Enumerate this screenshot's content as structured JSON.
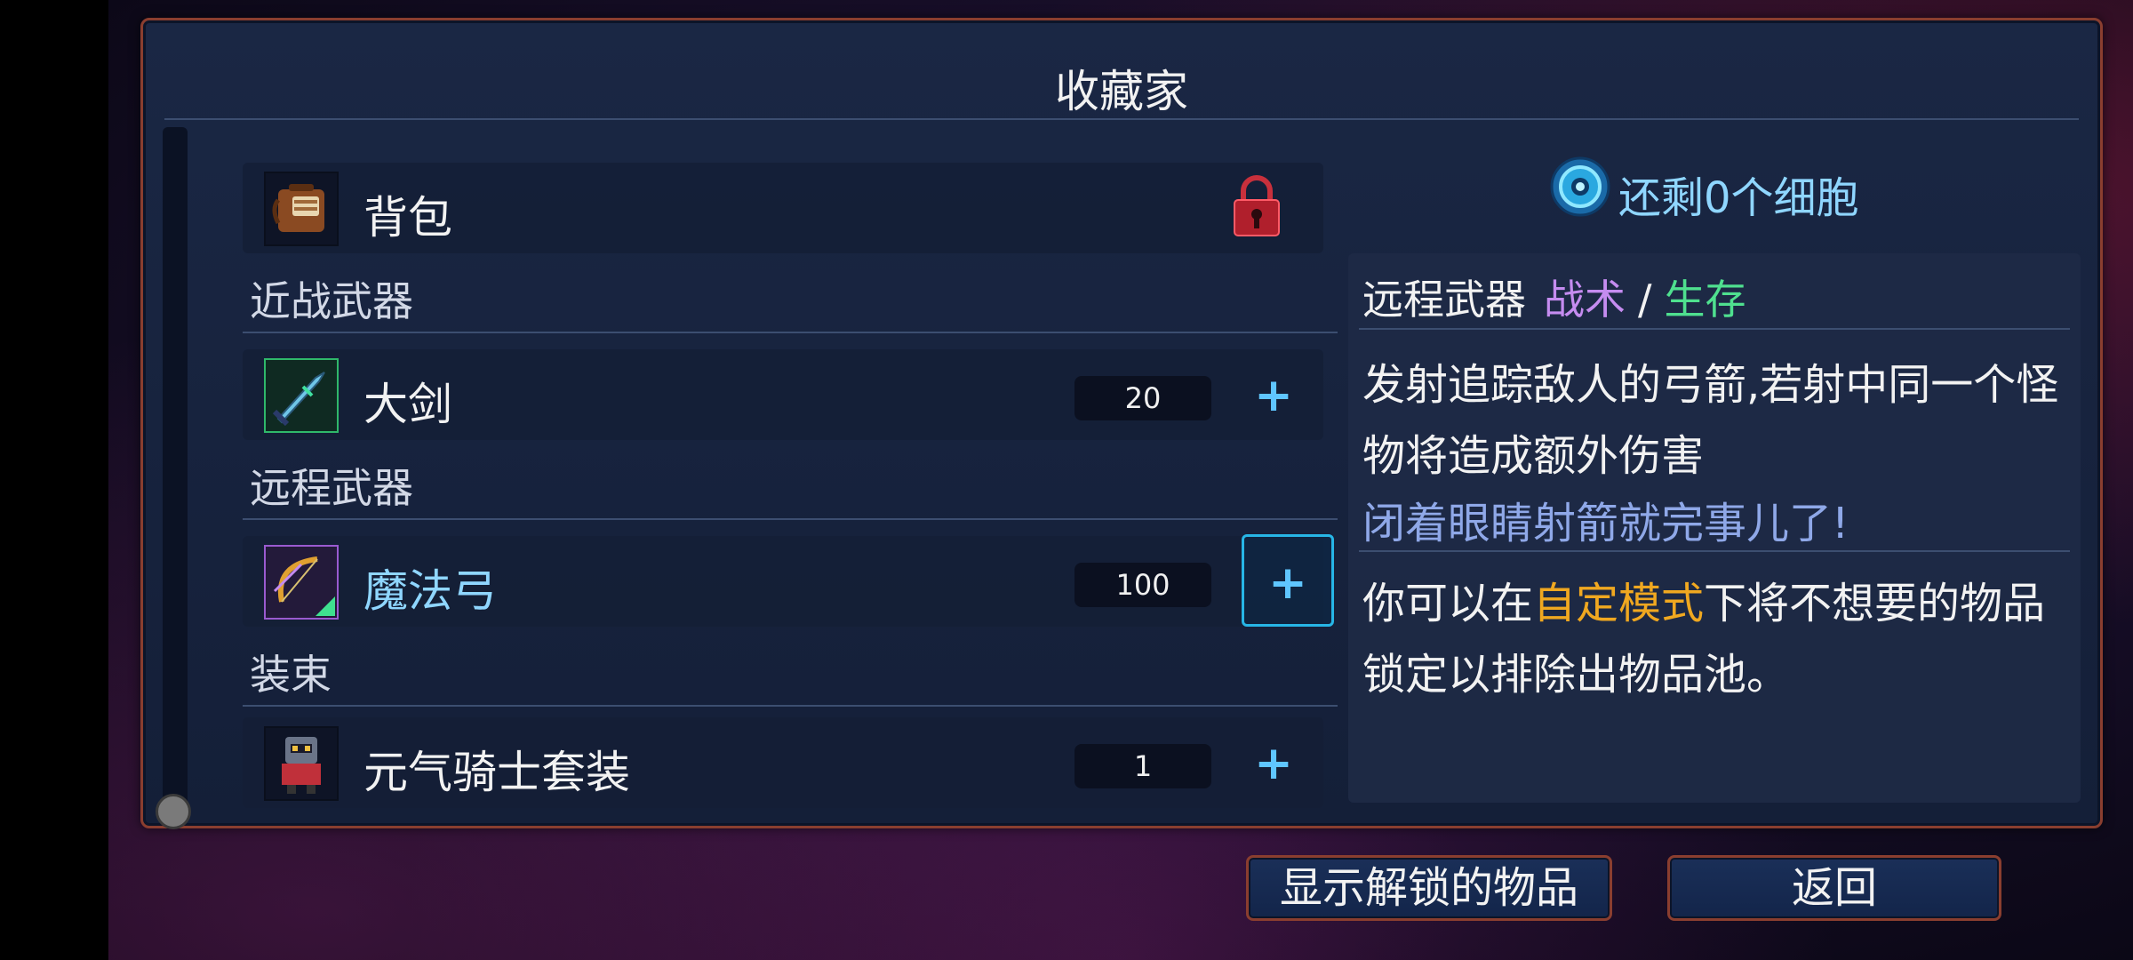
{
  "title": "收藏家",
  "cells": {
    "text": "还剩0个细胞"
  },
  "list": {
    "backpack": {
      "label": "背包"
    },
    "sections": {
      "melee": "近战武器",
      "ranged": "远程武器",
      "outfit": "装束"
    },
    "items": {
      "greatsword": {
        "label": "大剑",
        "count": "20"
      },
      "magic_bow": {
        "label": "魔法弓",
        "count": "100"
      },
      "knight_outfit": {
        "label": "元气骑士套装",
        "count": "1"
      }
    },
    "plus_symbol": "+"
  },
  "detail": {
    "category": "远程武器",
    "tag1": "战术",
    "slash": "/",
    "tag2": "生存",
    "description": "发射追踪敌人的弓箭,若射中同一个怪物将造成额外伤害",
    "flavor": "闭着眼睛射箭就完事儿了!",
    "tip_part1": "你可以在",
    "tip_mode": "自定模式",
    "tip_part2": "下将不想要的物品锁定以排除出物品池。"
  },
  "buttons": {
    "show_unlocked": "显示解锁的物品",
    "back": "返回"
  },
  "colors": {
    "frame_border": "#8a3e2f",
    "accent_cyan": "#5fc6ff",
    "tactics_purple": "#c58cf0",
    "survival_green": "#4fe08f",
    "mode_orange": "#f0a820"
  },
  "icons": [
    "backpack-icon",
    "lock-icon",
    "greatsword-icon",
    "magic-bow-icon",
    "knight-outfit-icon",
    "cell-icon"
  ]
}
